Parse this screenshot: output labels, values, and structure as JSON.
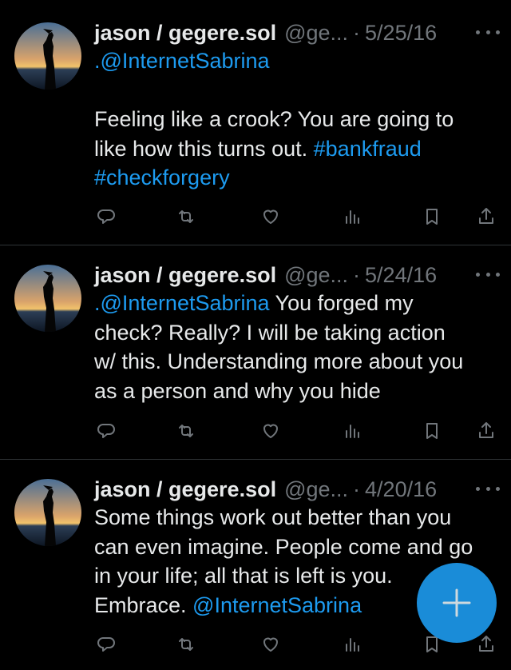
{
  "tweets": [
    {
      "name": "jason / gegere.sol",
      "handle": "@ge...",
      "separator": "·",
      "date": "5/25/16",
      "lines": [
        [
          {
            "text": ".@InternetSabrina",
            "link": true
          }
        ],
        [
          {
            "text": "",
            "link": false
          }
        ],
        [
          {
            "text": "Feeling like a crook? You are going to",
            "link": false
          }
        ],
        [
          {
            "text": "like how this turns out. ",
            "link": false
          },
          {
            "text": "#bankfraud",
            "link": true
          }
        ],
        [
          {
            "text": "#checkforgery",
            "link": true
          }
        ]
      ]
    },
    {
      "name": "jason / gegere.sol",
      "handle": "@ge...",
      "separator": "·",
      "date": "5/24/16",
      "lines": [
        [
          {
            "text": ".@InternetSabrina",
            "link": true
          },
          {
            "text": " You forged my",
            "link": false
          }
        ],
        [
          {
            "text": "check? Really? I will be taking action",
            "link": false
          }
        ],
        [
          {
            "text": "w/ this. Understanding more about you",
            "link": false
          }
        ],
        [
          {
            "text": "as a person and why you hide",
            "link": false
          }
        ]
      ]
    },
    {
      "name": "jason / gegere.sol",
      "handle": "@ge...",
      "separator": "·",
      "date": "4/20/16",
      "lines": [
        [
          {
            "text": "Some things work out better than you",
            "link": false
          }
        ],
        [
          {
            "text": "can even imagine. People come and go",
            "link": false
          }
        ],
        [
          {
            "text": "in your life; all that is left is you.",
            "link": false
          }
        ],
        [
          {
            "text": "Embrace. ",
            "link": false
          },
          {
            "text": "@InternetSabrina",
            "link": true
          }
        ]
      ]
    }
  ],
  "actions": [
    "reply-icon",
    "retweet-icon",
    "like-icon",
    "views-icon",
    "bookmark-icon",
    "share-icon"
  ],
  "colors": {
    "link": "#1d9bf0",
    "muted": "#71767b",
    "fab": "#1a8cd8",
    "background": "#000000"
  },
  "fab_icon": "plus-icon"
}
